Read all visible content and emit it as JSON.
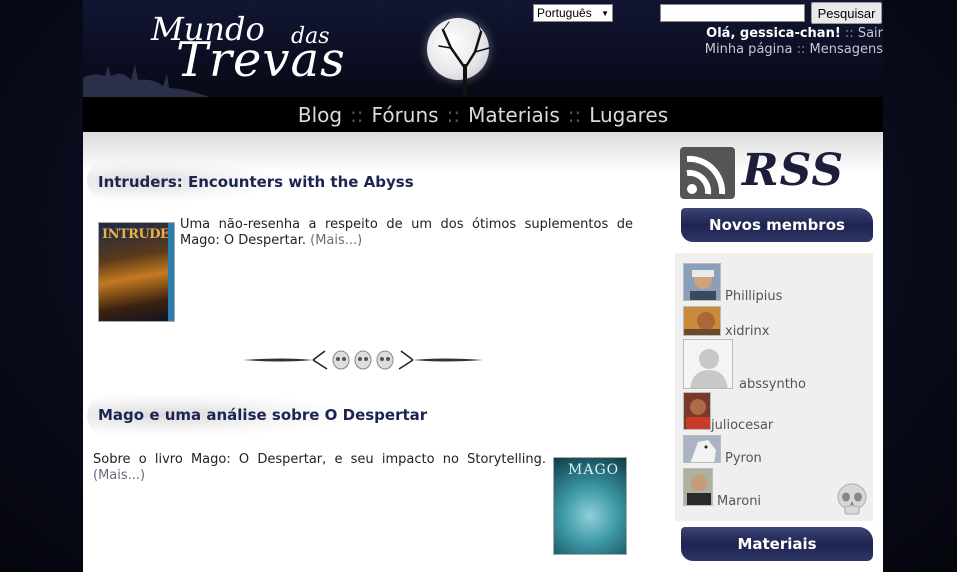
{
  "header": {
    "logo": {
      "line1": "Mundo",
      "line2": "das",
      "line3": "Trevas"
    },
    "language": "Português",
    "search": {
      "placeholder": "",
      "button": "Pesquisar"
    },
    "user": {
      "greeting": "Olá, gessica-chan!",
      "logout": "Sair",
      "my_page": "Minha página",
      "messages": "Mensagens",
      "separator": "::"
    }
  },
  "nav": {
    "items": [
      "Blog",
      "Fóruns",
      "Materiais",
      "Lugares"
    ],
    "separator": "::"
  },
  "posts": [
    {
      "title": "Intruders: Encounters with the Abyss",
      "excerpt": "Uma não-resenha a respeito de um dos ótimos suplementos de Mago: O Despertar.",
      "more": "(Mais...)",
      "thumb_title": "INTRUDERS"
    },
    {
      "title": "Mago e uma análise sobre O Despertar",
      "excerpt": "Sobre o livro Mago: O Despertar, e seu impacto no Storytelling.",
      "more": "(Mais...)",
      "thumb_title": "MAGO"
    }
  ],
  "sidebar": {
    "rss_label": "RSS",
    "new_members_title": "Novos membros",
    "members": [
      "Phillipius",
      "xidrinx",
      "abssyntho",
      "juliocesar",
      "Pyron",
      "Maroni"
    ],
    "materials_title": "Materiais"
  },
  "colors": {
    "title": "#1c2451",
    "banner": "#1e2450",
    "nav_bg": "#000000",
    "header_bg": "#0b0e22"
  }
}
